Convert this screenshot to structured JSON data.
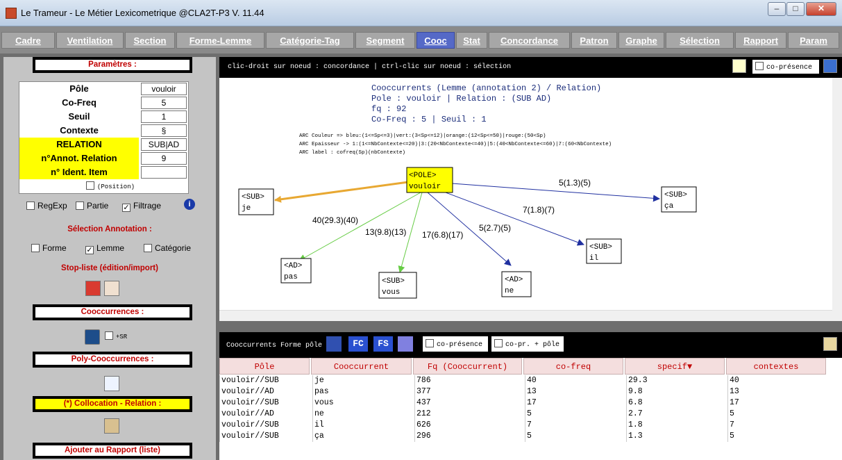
{
  "window": {
    "title": "Le Trameur - Le Métier Lexicometrique @CLA2T-P3 V. 11.44"
  },
  "tabs": [
    "Cadre",
    "Ventilation",
    "Section",
    "Forme-Lemme",
    "Catégorie-Tag",
    "Segment",
    "Cooc",
    "Stat",
    "Concordance",
    "Patron",
    "Graphe",
    "Sélection",
    "Rapport",
    "Param"
  ],
  "left": {
    "params_title": "Paramètres :",
    "params": [
      {
        "label": "Pôle",
        "value": "vouloir"
      },
      {
        "label": "Co-Freq",
        "value": "5"
      },
      {
        "label": "Seuil",
        "value": "1"
      },
      {
        "label": "Contexte",
        "value": "§"
      },
      {
        "label": "RELATION",
        "value": "SUB|AD"
      },
      {
        "label": "n°Annot. Relation",
        "value": "9"
      },
      {
        "label": "n° Ident. Item",
        "value": ""
      }
    ],
    "position_label": "(Position)",
    "regexp": "RegExp",
    "partie": "Partie",
    "filtrage": "Filtrage",
    "selection_annotation": "Sélection Annotation :",
    "forme": "Forme",
    "lemme": "Lemme",
    "categorie": "Catégorie",
    "stopliste": "Stop-liste (édition/import)",
    "cooccurrences": "Cooccurrences :",
    "sr": "+SR",
    "poly": "Poly-Cooccurrences :",
    "collocation": "(*) Collocation - Relation :",
    "ajouter": "Ajouter au Rapport (liste)"
  },
  "graph": {
    "hint": "clic-droit sur noeud : concordance | ctrl-clic sur noeud : sélection",
    "copresence": "co-présence",
    "header": [
      "Cooccurrents (Lemme (annotation 2) / Relation)",
      "Pole : vouloir | Relation : (SUB AD)",
      "fq : 92",
      "Co-Freq : 5 | Seuil : 1"
    ],
    "legend": [
      "ARC Couleur => bleu:(1<=Sp<=3)|vert:(3<Sp<=12)|orange:(12<Sp<=50)|rouge:(50<Sp)",
      "ARC Epaisseur -> 1:(1<=NbContexte<=20)|3:(20<NbContexte<=40)|5:(40<NbContexte<=60)|7:(60<NbContexte)",
      "ARC label : cofreq(Sp)(nbContexte)"
    ],
    "pole": {
      "tag": "<POLE>",
      "word": "vouloir"
    },
    "nodes": [
      {
        "tag": "<SUB>",
        "word": "je",
        "edge": "40(29.3)(40)",
        "color": "orange"
      },
      {
        "tag": "<AD>",
        "word": "pas",
        "edge": "13(9.8)(13)",
        "color": "green"
      },
      {
        "tag": "<SUB>",
        "word": "vous",
        "edge": "17(6.8)(17)",
        "color": "green"
      },
      {
        "tag": "<AD>",
        "word": "ne",
        "edge": "5(2.7)(5)",
        "color": "blue"
      },
      {
        "tag": "<SUB>",
        "word": "il",
        "edge": "7(1.8)(7)",
        "color": "blue"
      },
      {
        "tag": "<SUB>",
        "word": "ça",
        "edge": "5(1.3)(5)",
        "color": "blue"
      }
    ]
  },
  "lower": {
    "title": "Cooccurrents Forme pôle",
    "copresence": "co-présence",
    "copr_pole": "co-pr. + pôle",
    "columns": [
      "Pôle",
      "Cooccurrent",
      "Fq (Cooccurrent)",
      "co-freq",
      "specif▼",
      "contextes"
    ],
    "rows": [
      [
        "vouloir//SUB",
        "je",
        "786",
        "40",
        "29.3",
        "40"
      ],
      [
        "vouloir//AD",
        "pas",
        "377",
        "13",
        "9.8",
        "13"
      ],
      [
        "vouloir//SUB",
        "vous",
        "437",
        "17",
        "6.8",
        "17"
      ],
      [
        "vouloir//AD",
        "ne",
        "212",
        "5",
        "2.7",
        "5"
      ],
      [
        "vouloir//SUB",
        "il",
        "626",
        "7",
        "1.8",
        "7"
      ],
      [
        "vouloir//SUB",
        "ça",
        "296",
        "5",
        "1.3",
        "5"
      ]
    ]
  },
  "colors": {
    "orange": "#e8a832",
    "green": "#66cc44",
    "blue": "#2030a0",
    "accent": "#5569c7"
  }
}
